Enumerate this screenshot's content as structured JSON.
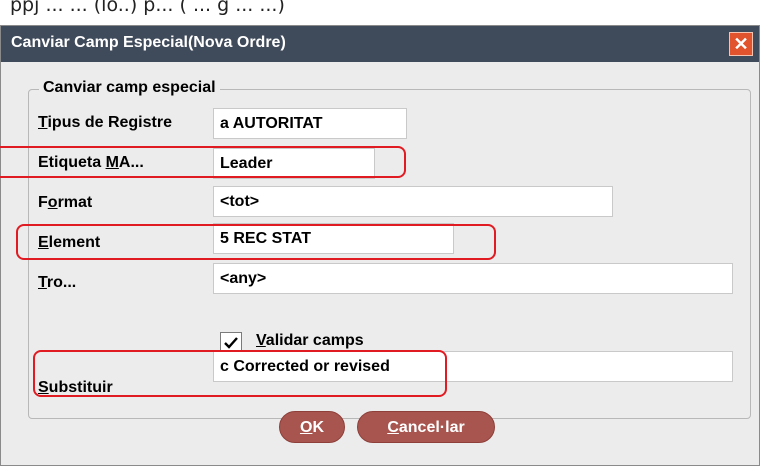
{
  "background_caption": "ppj  ...  ...  (lo..)  p... (  ... g ... ...)",
  "window": {
    "title": "Canviar Camp Especial(Nova Ordre)",
    "close_glyph": "✕"
  },
  "group": {
    "title": "Canviar camp especial"
  },
  "form": {
    "record_type": {
      "label_prefix": "T",
      "label_rest": "ipus de Registre",
      "value": "a  AUTORITAT"
    },
    "marc_tag": {
      "label_prefix": "Etiqueta ",
      "label_u": "M",
      "label_rest": "A...",
      "value": "Leader"
    },
    "format": {
      "label_prefix": "F",
      "label_u": "o",
      "label_rest": "rmat",
      "value": "<tot>"
    },
    "element": {
      "label_u": "E",
      "label_rest": "lement",
      "value": "5  REC STAT"
    },
    "segment": {
      "label_u": "T",
      "label_rest": "ro...",
      "value": "<any>"
    },
    "validate": {
      "label_u": "V",
      "label_rest": "alidar camps",
      "checked": true
    },
    "replace": {
      "label_u": "S",
      "label_rest": "ubstituir",
      "value": "c Corrected or revised"
    }
  },
  "buttons": {
    "ok_u": "O",
    "ok_rest": "K",
    "cancel_u": "C",
    "cancel_rest": "ancel·lar"
  },
  "colors": {
    "title_bar": "#3f4a5a",
    "close_button": "#e0532c",
    "button": "#a8554f",
    "highlight": "#e11b22"
  }
}
